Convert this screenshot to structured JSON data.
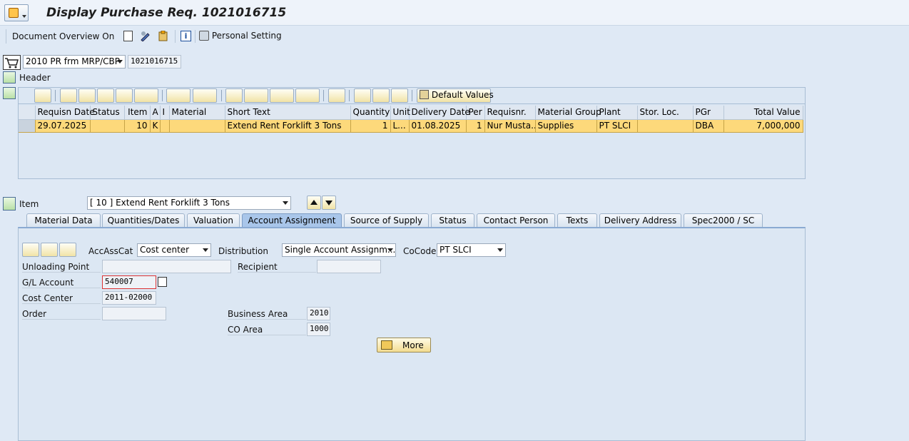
{
  "window": {
    "title": "Display Purchase Req. 1021016715"
  },
  "app_toolbar": {
    "doc_overview": "Document Overview On",
    "personal_setting": "Personal Setting"
  },
  "header_line": {
    "doc_type": "2010 PR frm MRP/CBP",
    "doc_number": "1021016715",
    "header_label": "Header"
  },
  "grid_toolbar": {
    "default_values": "Default Values"
  },
  "items_table": {
    "columns": [
      "Requisn Date",
      "Status",
      "Item",
      "A",
      "I",
      "Material",
      "Short Text",
      "Quantity",
      "Unit",
      "Delivery Date",
      "Per",
      "Requisnr.",
      "Material Group",
      "Plant",
      "Stor. Loc.",
      "PGr",
      "Total Value"
    ],
    "rows": [
      [
        "29.07.2025",
        "",
        "10",
        "K",
        "",
        "",
        "Extend Rent Forklift 3 Tons",
        "1",
        "L...",
        "01.08.2025",
        "1",
        "Nur Musta...",
        "Supplies",
        "PT SLCI",
        "",
        "DBA",
        "7,000,000"
      ]
    ]
  },
  "item_section": {
    "label": "Item",
    "selected": "[ 10 ] Extend Rent Forklift 3 Tons"
  },
  "tabs": [
    "Material Data",
    "Quantities/Dates",
    "Valuation",
    "Account Assignment",
    "Source of Supply",
    "Status",
    "Contact Person",
    "Texts",
    "Delivery Address",
    "Spec2000 / SC"
  ],
  "active_tab": "Account Assignment",
  "account_assignment": {
    "accasscat_label": "AccAssCat",
    "accasscat_value": "Cost center",
    "distribution_label": "Distribution",
    "distribution_value": "Single Account Assignm...",
    "cocode_label": "CoCode",
    "cocode_value": "PT SLCI",
    "unloading_label": "Unloading Point",
    "unloading_value": "",
    "recipient_label": "Recipient",
    "recipient_value": "",
    "gl_label": "G/L Account",
    "gl_value": "540007",
    "costcenter_label": "Cost Center",
    "costcenter_value": "2011-02000",
    "order_label": "Order",
    "order_value": "",
    "busarea_label": "Business Area",
    "busarea_value": "2010",
    "coarea_label": "CO Area",
    "coarea_value": "1000",
    "more_label": "More"
  }
}
